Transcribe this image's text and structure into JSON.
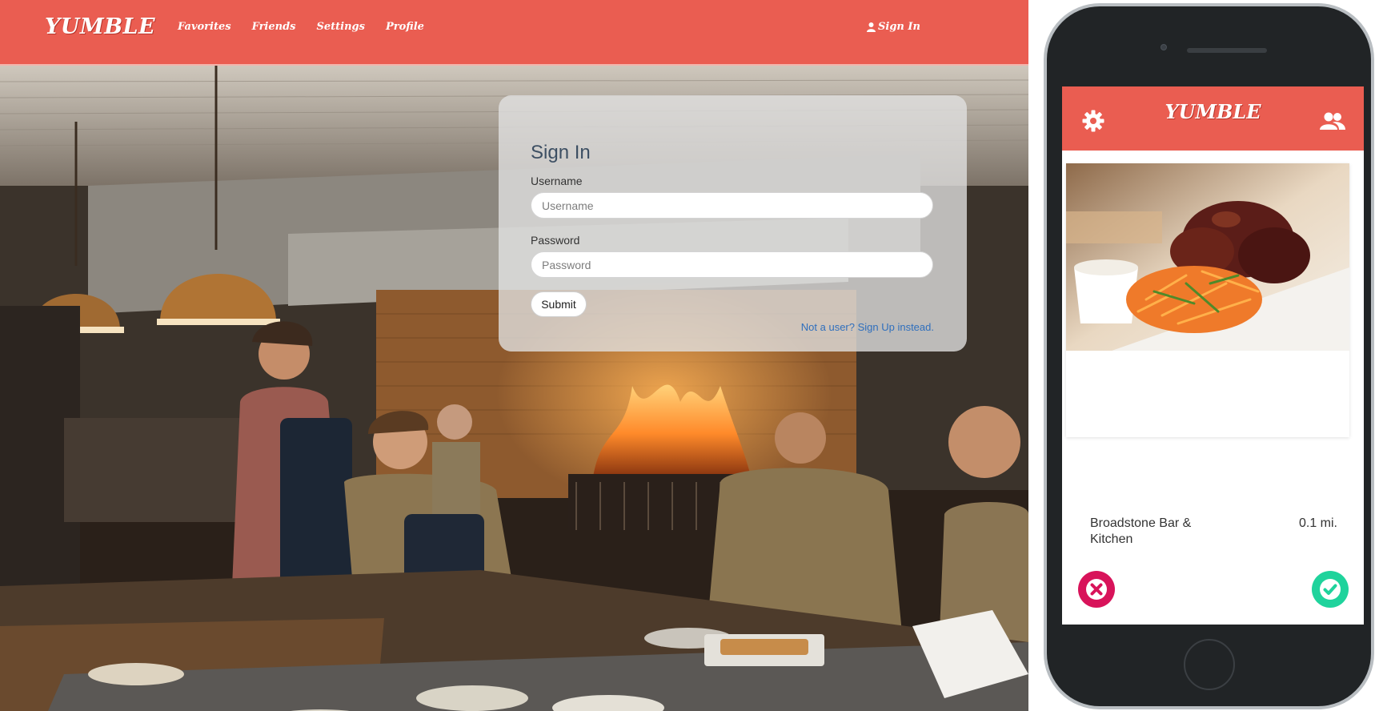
{
  "desktop": {
    "navbar": {
      "brand": "YUMBLE",
      "links": [
        "Favorites",
        "Friends",
        "Settings",
        "Profile"
      ],
      "sign_in": "Sign In",
      "color": "#ea5d51"
    },
    "signin_form": {
      "title": "Sign In",
      "username_label": "Username",
      "username_placeholder": "Username",
      "password_label": "Password",
      "password_placeholder": "Password",
      "submit_label": "Submit",
      "signup_link": "Not a user? Sign Up instead."
    }
  },
  "mobile": {
    "header": {
      "brand": "YUMBLE",
      "left_icon": "gear-icon",
      "right_icon": "friends-icon"
    },
    "card": {
      "restaurant_name": "Broadstone Bar & Kitchen",
      "distance": "0.1 mi."
    },
    "actions": {
      "reject_icon": "x-icon",
      "accept_icon": "check-icon",
      "reject_color": "#d8135a",
      "accept_color": "#1fd39c"
    }
  }
}
